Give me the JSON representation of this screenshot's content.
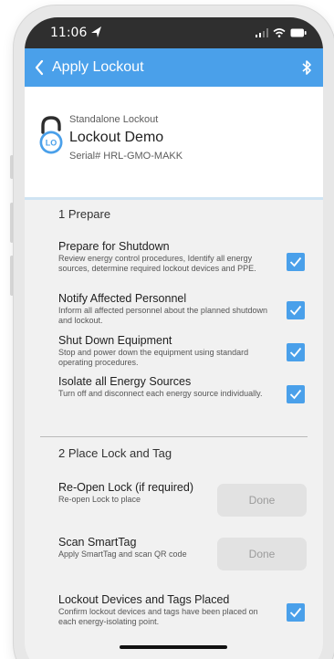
{
  "status_bar": {
    "time": "11:06",
    "icons": [
      "signal-icon",
      "wifi-icon",
      "battery-icon"
    ]
  },
  "header": {
    "title": "Apply Lockout",
    "back_icon": "chevron-left-icon",
    "action_icon": "bluetooth-icon"
  },
  "device": {
    "type": "Standalone Lockout",
    "name": "Lockout Demo",
    "serial": "Serial# HRL-GMO-MAKK",
    "logo_text": "LO"
  },
  "sections": [
    {
      "title": "1 Prepare",
      "steps": [
        {
          "title": "Prepare for Shutdown",
          "description": "Review energy control procedures, Identify all energy sources, determine required lockout devices and PPE.",
          "checked": true
        },
        {
          "title": "Notify Affected Personnel",
          "description": "Inform all affected personnel about the planned shutdown and lockout.",
          "checked": true
        },
        {
          "title": "Shut Down Equipment",
          "description": "Stop and power down the equipment using standard operating procedures.",
          "checked": true
        },
        {
          "title": "Isolate all Energy Sources",
          "description": "Turn off and disconnect each energy source individually.",
          "checked": true
        }
      ]
    },
    {
      "title": "2 Place Lock and Tag",
      "steps": [
        {
          "title": "Re-Open Lock (if required)",
          "description": "Re-open Lock to place",
          "action_label": "Done"
        },
        {
          "title": "Scan SmartTag",
          "description": "Apply SmartTag and scan QR code",
          "action_label": "Done"
        },
        {
          "title": "Lockout Devices and Tags Placed",
          "description": "Confirm lockout devices and tags have been placed on each energy-isolating point.",
          "checked": true
        }
      ]
    }
  ],
  "colors": {
    "accent": "#4aa0ea",
    "status_bar": "#2f2f2f",
    "background": "#f1f1f1",
    "button_disabled": "#e2e2e2"
  }
}
